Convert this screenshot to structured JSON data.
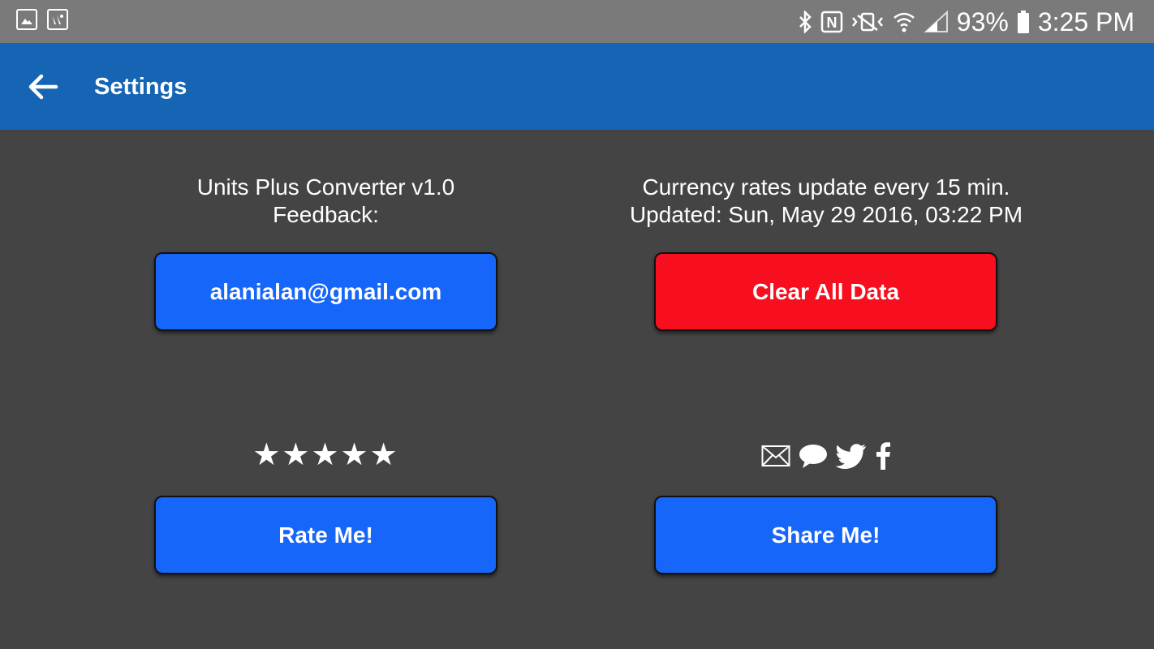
{
  "status_bar": {
    "battery": "93%",
    "time": "3:25 PM",
    "icons": [
      "gallery-icon",
      "voicemail-icon",
      "bluetooth-icon",
      "nfc-icon",
      "vibrate-icon",
      "wifi-icon",
      "signal-icon",
      "battery-icon"
    ]
  },
  "app_bar": {
    "title": "Settings",
    "back_icon": "arrow-left-icon"
  },
  "left_panel": {
    "app_version": "Units Plus Converter v1.0",
    "feedback_label": "Feedback:",
    "email_button": "alanialan@gmail.com",
    "stars": "★★★★★",
    "rate_button": "Rate Me!"
  },
  "right_panel": {
    "currency_info": "Currency rates update every 15 min.",
    "updated_info": "Updated: Sun, May 29 2016, 03:22 PM",
    "clear_button": "Clear All Data",
    "share_icons": [
      "mail-icon",
      "chat-icon",
      "twitter-icon",
      "facebook-icon"
    ],
    "share_button": "Share Me!"
  },
  "colors": {
    "status_bar": "#7a7a7a",
    "app_bar": "#1565b4",
    "background": "#444444",
    "blue_button": "#1766fa",
    "red_button": "#f70e1f"
  }
}
